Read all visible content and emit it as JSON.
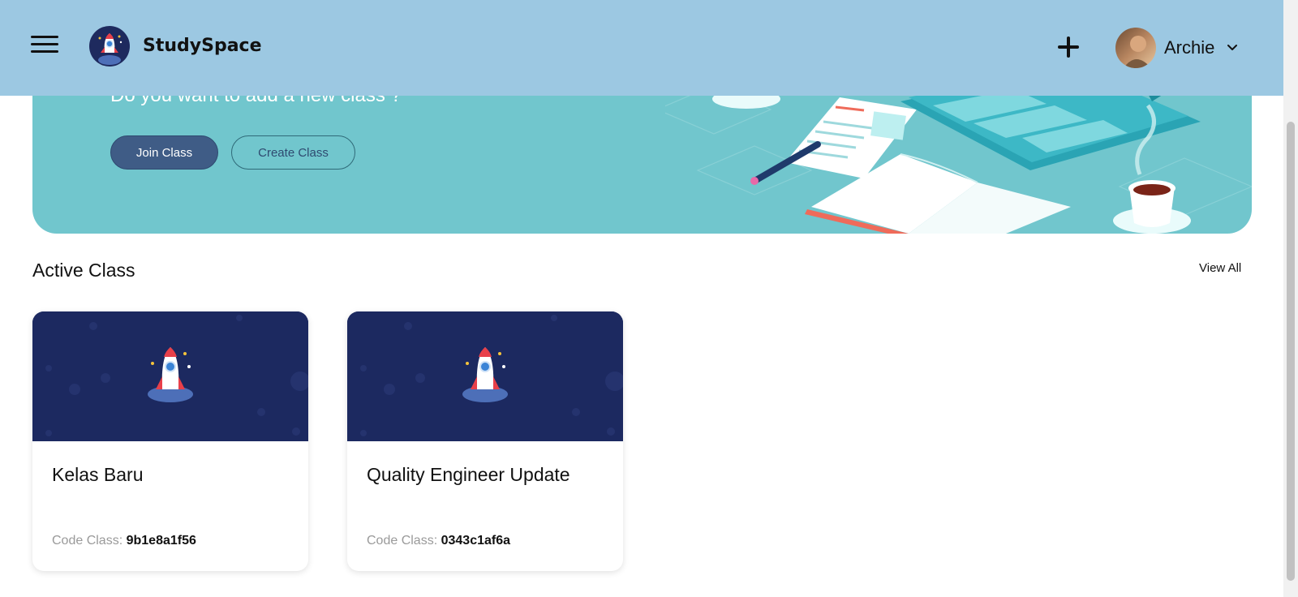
{
  "header": {
    "brand": "StudySpace",
    "user_name": "Archie"
  },
  "banner": {
    "subtitle": "Do you want to add a new class ?",
    "join_label": "Join Class",
    "create_label": "Create Class"
  },
  "section": {
    "title": "Active Class",
    "view_all_label": "View All"
  },
  "classes": [
    {
      "title": "Kelas Baru",
      "code_label": "Code Class:",
      "code": "9b1e8a1f56"
    },
    {
      "title": "Quality Engineer Update",
      "code_label": "Code Class:",
      "code": "0343c1af6a"
    }
  ],
  "colors": {
    "header_bg": "#9cc8e2",
    "banner_bg": "#71c6cd",
    "join_button": "#3f5c86",
    "card_cover": "#1c2960"
  },
  "icons": {
    "menu": "hamburger-icon",
    "logo": "rocket-logo",
    "add": "plus-icon",
    "dropdown": "chevron-down-icon"
  }
}
